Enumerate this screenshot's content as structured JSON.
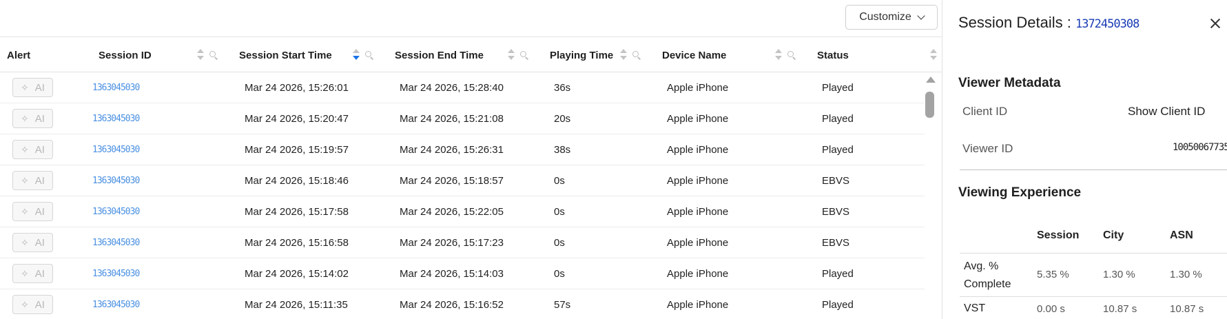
{
  "toolbar": {
    "customize_label": "Customize"
  },
  "table": {
    "columns": [
      {
        "key": "alert",
        "label": "Alert"
      },
      {
        "key": "session_id",
        "label": "Session ID"
      },
      {
        "key": "start",
        "label": "Session Start Time"
      },
      {
        "key": "end",
        "label": "Session End Time"
      },
      {
        "key": "playing",
        "label": "Playing Time"
      },
      {
        "key": "device",
        "label": "Device Name"
      },
      {
        "key": "status",
        "label": "Status"
      }
    ],
    "sort": {
      "column": "start",
      "direction": "desc"
    },
    "ai_label": "AI",
    "rows": [
      {
        "session_id": "1363045030",
        "start": "Mar 24 2026, 15:26:01",
        "end": "Mar 24 2026, 15:28:40",
        "playing": "36s",
        "device": "Apple iPhone",
        "status": "Played"
      },
      {
        "session_id": "1363045030",
        "start": "Mar 24 2026, 15:20:47",
        "end": "Mar 24 2026, 15:21:08",
        "playing": "20s",
        "device": "Apple iPhone",
        "status": "Played"
      },
      {
        "session_id": "1363045030",
        "start": "Mar 24 2026, 15:19:57",
        "end": "Mar 24 2026, 15:26:31",
        "playing": "38s",
        "device": "Apple iPhone",
        "status": "Played"
      },
      {
        "session_id": "1363045030",
        "start": "Mar 24 2026, 15:18:46",
        "end": "Mar 24 2026, 15:18:57",
        "playing": "0s",
        "device": "Apple iPhone",
        "status": "EBVS"
      },
      {
        "session_id": "1363045030",
        "start": "Mar 24 2026, 15:17:58",
        "end": "Mar 24 2026, 15:22:05",
        "playing": "0s",
        "device": "Apple iPhone",
        "status": "EBVS"
      },
      {
        "session_id": "1363045030",
        "start": "Mar 24 2026, 15:16:58",
        "end": "Mar 24 2026, 15:17:23",
        "playing": "0s",
        "device": "Apple iPhone",
        "status": "EBVS"
      },
      {
        "session_id": "1363045030",
        "start": "Mar 24 2026, 15:14:02",
        "end": "Mar 24 2026, 15:14:03",
        "playing": "0s",
        "device": "Apple iPhone",
        "status": "Played"
      },
      {
        "session_id": "1363045030",
        "start": "Mar 24 2026, 15:11:35",
        "end": "Mar 24 2026, 15:16:52",
        "playing": "57s",
        "device": "Apple iPhone",
        "status": "Played"
      }
    ]
  },
  "details": {
    "title_prefix": "Session Details : ",
    "session_id": "1372450308",
    "viewer_metadata": {
      "heading": "Viewer Metadata",
      "client_id_label": "Client ID",
      "client_id_action": "Show Client ID",
      "viewer_id_label": "Viewer ID",
      "viewer_id_value": "10050067735"
    },
    "viewing_experience": {
      "heading": "Viewing Experience",
      "columns": [
        "Session",
        "City",
        "ASN"
      ],
      "rows": [
        {
          "label": "Avg. % Complete",
          "values": [
            "5.35 %",
            "1.30 %",
            "1.30 %"
          ]
        },
        {
          "label": "VST",
          "values": [
            "0.00 s",
            "10.87 s",
            "10.87 s"
          ]
        }
      ]
    }
  },
  "colors": {
    "link": "#4a90e2",
    "sort_active": "#1a73e8"
  }
}
